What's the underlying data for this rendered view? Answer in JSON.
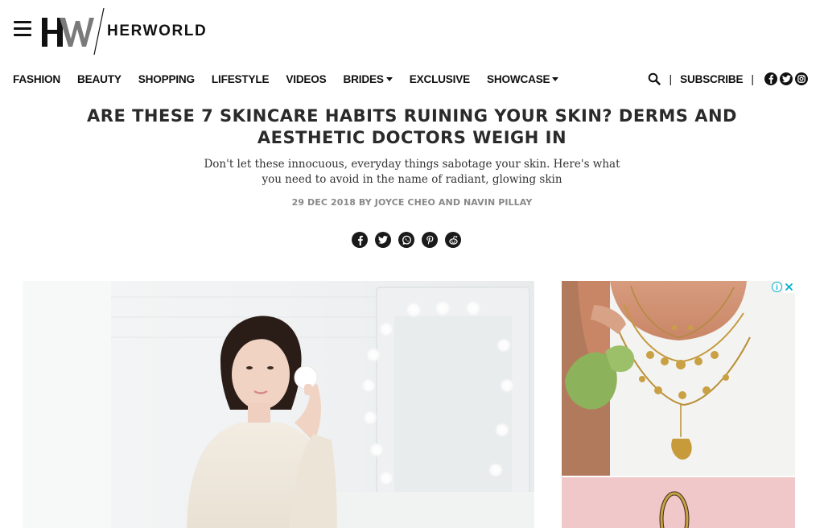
{
  "brand": {
    "logo_text": "HERWORLD",
    "logo_monogram": "HW"
  },
  "nav": {
    "items": [
      {
        "label": "FASHION",
        "dropdown": false
      },
      {
        "label": "BEAUTY",
        "dropdown": false
      },
      {
        "label": "SHOPPING",
        "dropdown": false
      },
      {
        "label": "LIFESTYLE",
        "dropdown": false
      },
      {
        "label": "VIDEOS",
        "dropdown": false
      },
      {
        "label": "BRIDES",
        "dropdown": true
      },
      {
        "label": "EXCLUSIVE",
        "dropdown": false
      },
      {
        "label": "SHOWCASE",
        "dropdown": true
      }
    ],
    "separator": "|",
    "subscribe_label": "SUBSCRIBE",
    "social_icons": [
      "facebook-icon",
      "twitter-icon",
      "instagram-icon"
    ]
  },
  "article": {
    "headline": "ARE THESE 7 SKINCARE HABITS RUINING YOUR SKIN? DERMS AND AESTHETIC DOCTORS WEIGH IN",
    "dek": "Don't let these innocuous, everyday things sabotage your skin. Here's what you need to avoid in the name of radiant, glowing skin",
    "byline": "29 DEC 2018 BY JOYCE CHEO AND NAVIN PILLAY",
    "share_icons": [
      "facebook-icon",
      "twitter-icon",
      "whatsapp-icon",
      "pinterest-icon",
      "reddit-icon"
    ]
  },
  "ad": {
    "info_icon": "i",
    "close_icon": "close-icon"
  },
  "colors": {
    "text": "#111111",
    "headline": "#2a2a2a",
    "byline": "#888888",
    "ad_accent": "#00aecd"
  }
}
